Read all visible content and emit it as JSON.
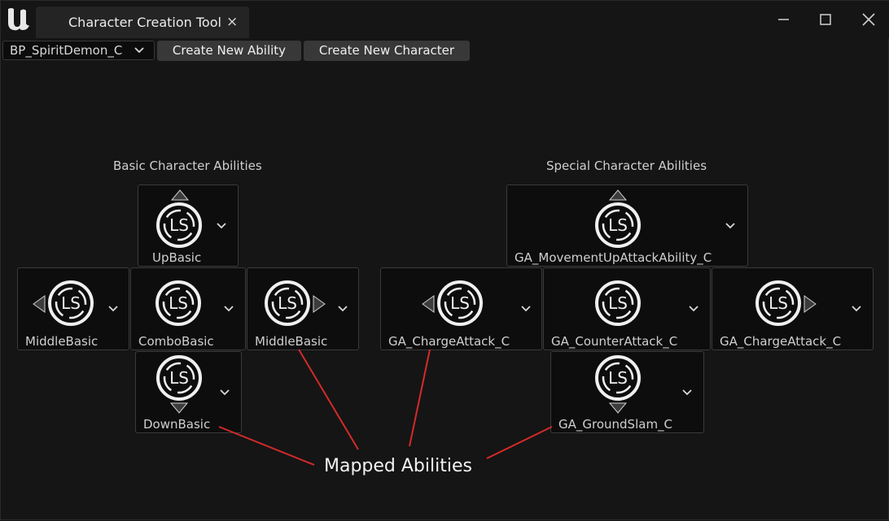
{
  "window": {
    "tab_title": "Character Creation Tool",
    "tab_close": "×"
  },
  "toolbar": {
    "dropdown_value": "BP_SpiritDemon_C",
    "create_ability_label": "Create New Ability",
    "create_character_label": "Create New Character"
  },
  "basic": {
    "title": "Basic Character Abilities",
    "up": "UpBasic",
    "middle_left": "MiddleBasic",
    "combo": "ComboBasic",
    "middle_right": "MiddleBasic",
    "down": "DownBasic"
  },
  "special": {
    "title": "Special Character Abilities",
    "up": "GA_MovementUpAttackAbility_C",
    "left": "GA_ChargeAttack_C",
    "center": "GA_CounterAttack_C",
    "right": "GA_ChargeAttack_C",
    "down": "GA_GroundSlam_C"
  },
  "annotation": {
    "label": "Mapped Abilities"
  },
  "icon_glyph": "LS",
  "colors": {
    "background": "#151515",
    "slot_bg": "#0d0d0d",
    "button_bg": "#383838",
    "annotation_line": "#d42a2a"
  }
}
